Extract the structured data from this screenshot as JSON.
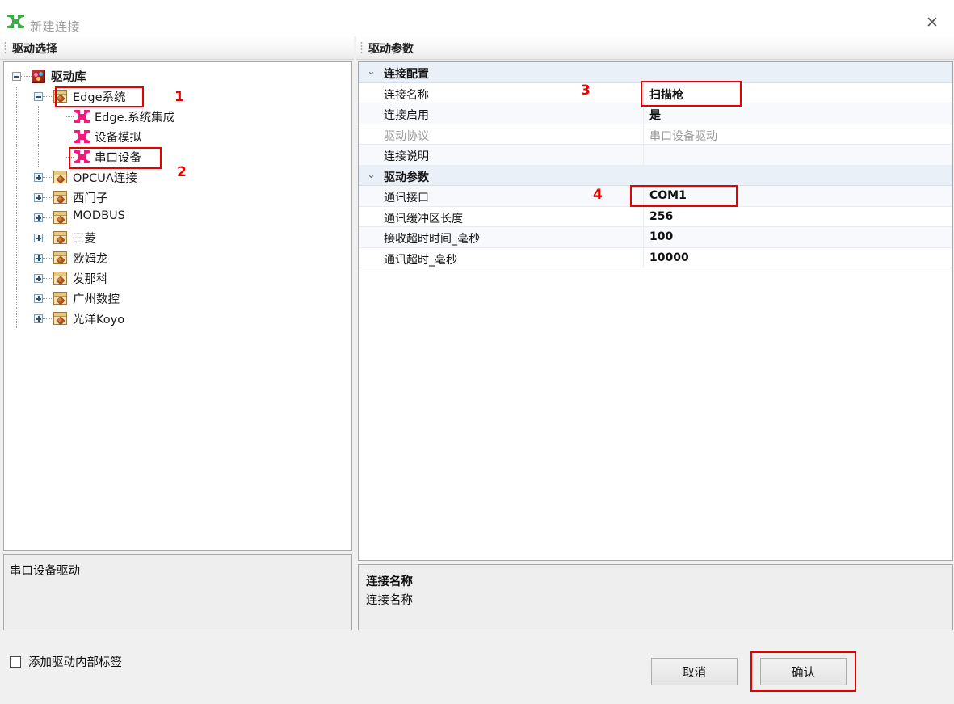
{
  "window": {
    "title": "新建连接",
    "icon": "connector-icon",
    "close_label": "✕"
  },
  "panels": {
    "left_header": "驱动选择",
    "right_header": "驱动参数"
  },
  "tree": {
    "root": {
      "label": "驱动库",
      "icon": "driver-library-icon",
      "expander": "minus"
    },
    "nodes": [
      {
        "label": "Edge系统",
        "icon": "folder-icon",
        "expander": "minus",
        "level": 1,
        "type": "folder"
      },
      {
        "label": "Edge.系统集成",
        "icon": "device-icon",
        "expander": "none",
        "level": 2,
        "type": "device"
      },
      {
        "label": "设备模拟",
        "icon": "device-icon",
        "expander": "none",
        "level": 2,
        "type": "device"
      },
      {
        "label": "串口设备",
        "icon": "device-icon",
        "expander": "none",
        "level": 2,
        "type": "device"
      },
      {
        "label": "OPCUA连接",
        "icon": "folder-icon",
        "expander": "plus",
        "level": 1,
        "type": "folder"
      },
      {
        "label": "西门子",
        "icon": "folder-icon",
        "expander": "plus",
        "level": 1,
        "type": "folder"
      },
      {
        "label": "MODBUS",
        "icon": "folder-icon",
        "expander": "plus",
        "level": 1,
        "type": "folder"
      },
      {
        "label": "三菱",
        "icon": "folder-icon",
        "expander": "plus",
        "level": 1,
        "type": "folder"
      },
      {
        "label": "欧姆龙",
        "icon": "folder-icon",
        "expander": "plus",
        "level": 1,
        "type": "folder"
      },
      {
        "label": "发那科",
        "icon": "folder-icon",
        "expander": "plus",
        "level": 1,
        "type": "folder"
      },
      {
        "label": "广州数控",
        "icon": "folder-icon",
        "expander": "plus",
        "level": 1,
        "type": "folder"
      },
      {
        "label": "光洋Koyo",
        "icon": "folder-icon",
        "expander": "plus",
        "level": 1,
        "type": "folder"
      }
    ]
  },
  "left_description": "串口设备驱动",
  "checkbox": {
    "label": "添加驱动内部标签",
    "checked": false
  },
  "property_grid": {
    "rows": [
      {
        "kind": "group",
        "chevron": "⌄",
        "name": "连接配置",
        "value": ""
      },
      {
        "kind": "prop",
        "name": "连接名称",
        "value": "扫描枪",
        "dim": false
      },
      {
        "kind": "prop",
        "name": "连接启用",
        "value": "是",
        "dim": false
      },
      {
        "kind": "prop",
        "name": "驱动协议",
        "value": "串口设备驱动",
        "dim": true
      },
      {
        "kind": "prop",
        "name": "连接说明",
        "value": "",
        "dim": false
      },
      {
        "kind": "group",
        "chevron": "⌄",
        "name": "驱动参数",
        "value": ""
      },
      {
        "kind": "prop",
        "name": "通讯接口",
        "value": "COM1",
        "dim": false
      },
      {
        "kind": "prop",
        "name": "通讯缓冲区长度",
        "value": "256",
        "dim": false
      },
      {
        "kind": "prop",
        "name": "接收超时时间_毫秒",
        "value": "100",
        "dim": false
      },
      {
        "kind": "prop",
        "name": "通讯超时_毫秒",
        "value": "10000",
        "dim": false
      }
    ]
  },
  "info": {
    "title": "连接名称",
    "text": "连接名称"
  },
  "buttons": {
    "cancel": "取消",
    "confirm": "确认"
  },
  "annotations": {
    "markers": [
      "1",
      "2",
      "3",
      "4"
    ],
    "color": "#e60000"
  }
}
